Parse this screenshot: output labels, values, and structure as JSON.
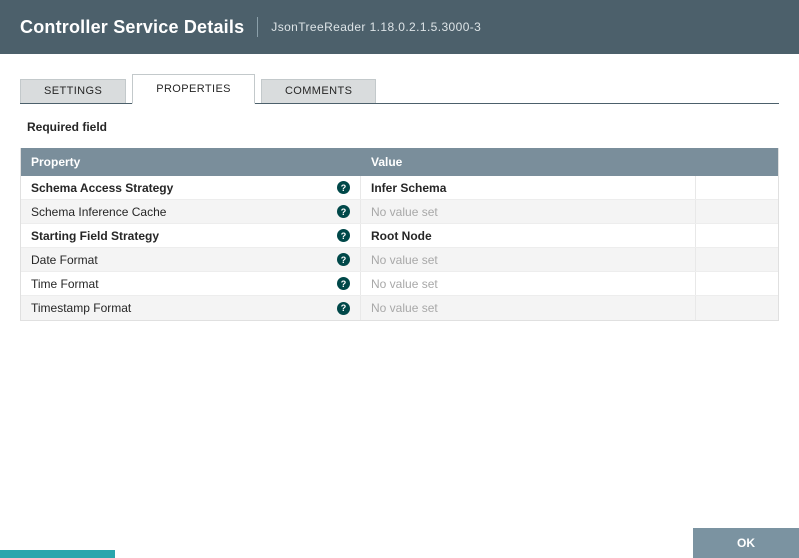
{
  "header": {
    "title": "Controller Service Details",
    "subtitle": "JsonTreeReader 1.18.0.2.1.5.3000-3"
  },
  "tabs": [
    {
      "label": "SETTINGS",
      "active": false
    },
    {
      "label": "PROPERTIES",
      "active": true
    },
    {
      "label": "COMMENTS",
      "active": false
    }
  ],
  "required_note": "Required field",
  "table": {
    "columns": [
      "Property",
      "Value"
    ],
    "rows": [
      {
        "property": "Schema Access Strategy",
        "required": true,
        "value": "Infer Schema",
        "value_set": true
      },
      {
        "property": "Schema Inference Cache",
        "required": false,
        "value": "No value set",
        "value_set": false
      },
      {
        "property": "Starting Field Strategy",
        "required": true,
        "value": "Root Node",
        "value_set": true
      },
      {
        "property": "Date Format",
        "required": false,
        "value": "No value set",
        "value_set": false
      },
      {
        "property": "Time Format",
        "required": false,
        "value": "No value set",
        "value_set": false
      },
      {
        "property": "Timestamp Format",
        "required": false,
        "value": "No value set",
        "value_set": false
      }
    ]
  },
  "icons": {
    "help": "question-circle-icon"
  },
  "footer": {
    "ok_label": "OK"
  },
  "colors": {
    "header_bg": "#4c606b",
    "table_header_bg": "#7a8e9b",
    "row_alt_bg": "#f4f4f4",
    "help_icon": "#004849",
    "ok_bg": "#7b93a1",
    "unset_text": "#a8a8a8",
    "accent_teal": "#2aa6ad"
  }
}
